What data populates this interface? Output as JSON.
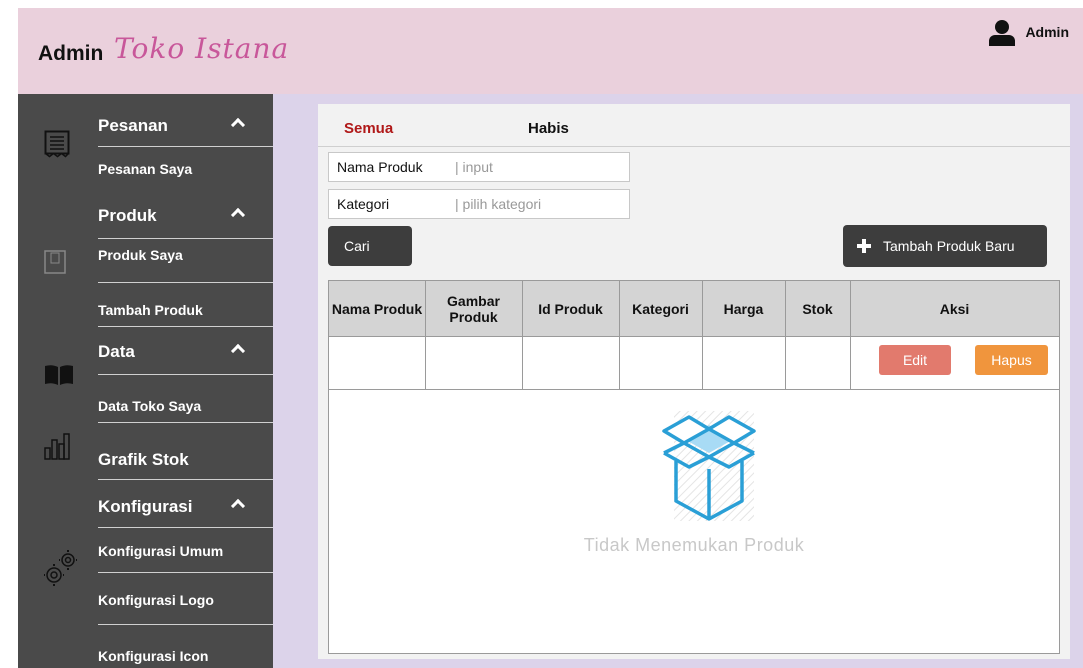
{
  "header": {
    "admin_label": "Admin",
    "store_name": "Toko Istana",
    "user_label": "Admin"
  },
  "sidebar": {
    "groups": [
      {
        "label": "Pesanan",
        "icon": "receipt-icon",
        "items": [
          "Pesanan Saya"
        ]
      },
      {
        "label": "Produk",
        "icon": "product-icon",
        "items": [
          "Produk Saya",
          "Tambah Produk"
        ]
      },
      {
        "label": "Data",
        "icon": "book-icon",
        "items": [
          "Data Toko Saya"
        ]
      },
      {
        "label": "Grafik Stok",
        "icon": "chart-icon",
        "items": []
      },
      {
        "label": "Konfigurasi",
        "icon": "gears-icon",
        "items": [
          "Konfigurasi Umum",
          "Konfigurasi Logo",
          "Konfigurasi Icon"
        ]
      }
    ]
  },
  "tabs": {
    "all": "Semua",
    "sold_out": "Habis"
  },
  "filters": {
    "name_label": "Nama Produk",
    "name_placeholder": "| input",
    "category_label": "Kategori",
    "category_placeholder": "| pilih kategori"
  },
  "buttons": {
    "search": "Cari",
    "add_product": "Tambah Produk Baru",
    "edit": "Edit",
    "delete": "Hapus"
  },
  "table": {
    "columns": [
      "Nama Produk",
      "Gambar Produk",
      "Id Produk",
      "Kategori",
      "Harga",
      "Stok",
      "Aksi"
    ]
  },
  "empty_state": {
    "text": "Tidak Menemukan Produk"
  },
  "colors": {
    "header_bg": "#ead0dc",
    "brand_accent": "#c8579a",
    "sidebar_bg": "#4a4a4a",
    "active_tab": "#b01818",
    "edit_button": "#e27a6d",
    "delete_button": "#f0953d",
    "empty_icon": "#2a9fd6"
  }
}
